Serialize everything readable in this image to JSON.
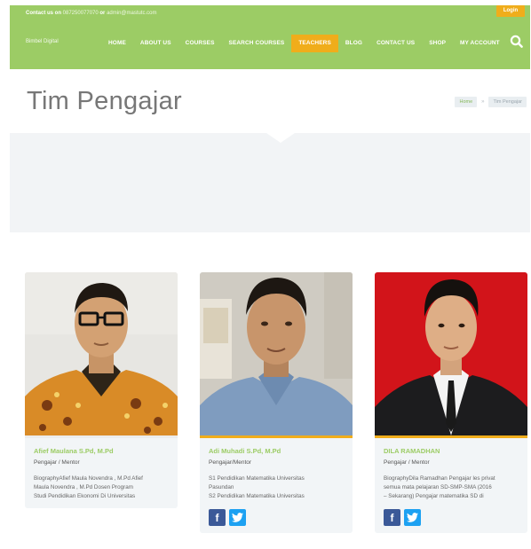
{
  "header": {
    "contact_prefix": "Contact us on",
    "contact_phone": "087250077070",
    "contact_mid": "or",
    "contact_email": "admin@mastutc.com",
    "login_label": "Login",
    "brand": "Bimbel Digital",
    "nav": [
      "HOME",
      "ABOUT US",
      "COURSES",
      "SEARCH COURSES",
      "TEACHERS",
      "BLOG",
      "CONTACT US",
      "SHOP",
      "MY ACCOUNT"
    ],
    "active_nav": "TEACHERS",
    "accent": "#9ccc65",
    "highlight": "#f0ad1b"
  },
  "page": {
    "title": "Tim Pengajar",
    "breadcrumb": [
      "Home",
      "Tim Pengajar"
    ],
    "breadcrumb_sep": "»"
  },
  "teachers": [
    {
      "name": "Afief Maulana S.Pd, M.Pd",
      "role": "Pengajar / Mentor",
      "bio": "BiographyAfief Maula Novendra , M.Pd Afief\nMaula Novendra , M.Pd Dosen Program\nStudi Pendidikan Ekonomi Di Universitas",
      "line_color": "#ececec",
      "socials": []
    },
    {
      "name": "Adi Muhadi S.Pd, M.Pd",
      "role": "Pengajar/Mentor",
      "bio": "S1 Pendidikan Matematika Universitas\nPasundan\nS2 Pendidikan Matematika Universitas",
      "line_color": "#f0ad1b",
      "socials": [
        "facebook-icon",
        "twitter-icon"
      ]
    },
    {
      "name": "DILA RAMADHAN",
      "role": "Pengajar / Mentor",
      "bio": "BiographyDila Ramadhan Pengajar les privat\nsemua mata pelajaran SD-SMP-SMA (2016\n– Sekarang) Pengajar matematika SD di",
      "line_color": "#f0ad1b",
      "socials": [
        "facebook-icon",
        "twitter-icon"
      ]
    }
  ]
}
